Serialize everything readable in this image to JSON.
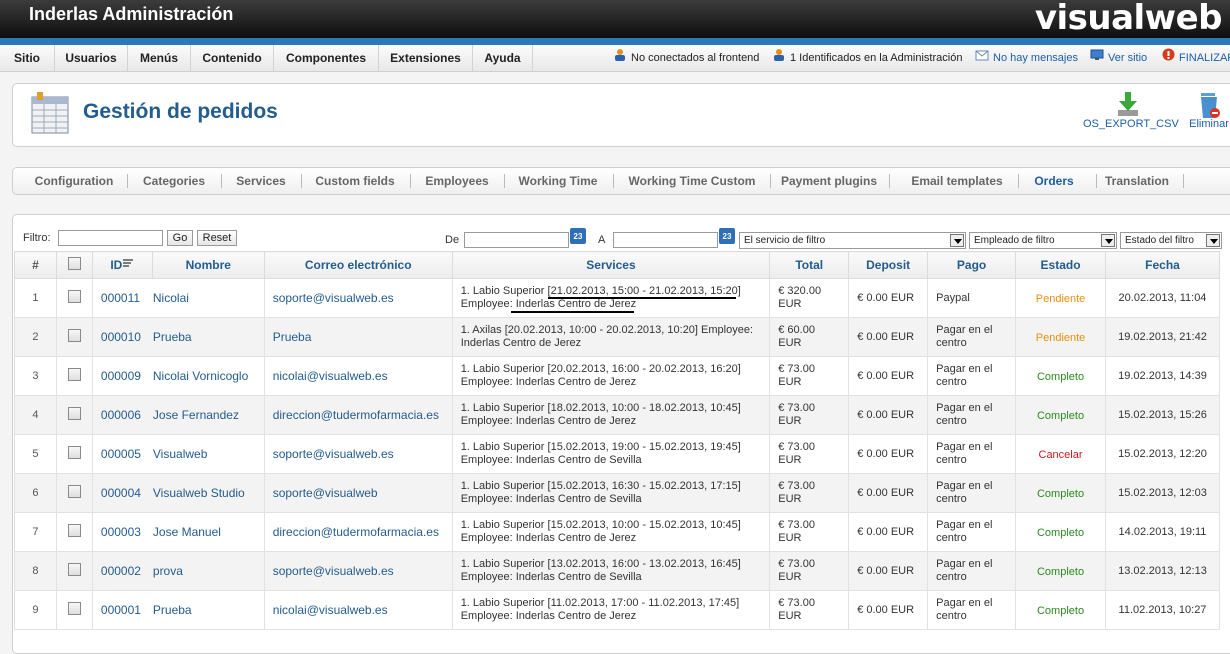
{
  "header": {
    "site_name": "Inderlas Administración",
    "logo": "visualweb"
  },
  "menu": [
    "Sitio",
    "Usuarios",
    "Menús",
    "Contenido",
    "Componentes",
    "Extensiones",
    "Ayuda"
  ],
  "status": {
    "frontend": "No conectados al frontend",
    "admin": "1 Identificados en la Administración",
    "messages": "No hay mensajes",
    "view_site": "Ver sitio",
    "logout": "FINALIZAR"
  },
  "page": {
    "title": "Gestión de pedidos",
    "export_label": "OS_EXPORT_CSV",
    "delete_label": "Eliminar"
  },
  "tabs": [
    "Configuration",
    "Categories",
    "Services",
    "Custom fields",
    "Employees",
    "Working Time",
    "Working Time Custom",
    "Payment plugins",
    "Email templates",
    "Orders",
    "Translation"
  ],
  "filter": {
    "label": "Filtro:",
    "go": "Go",
    "reset": "Reset",
    "from": "De",
    "to": "A",
    "cal": "23",
    "service_filter": "El servicio de filtro",
    "employee_filter": "Empleado de filtro",
    "status_filter": "Estado del filtro"
  },
  "columns": [
    "#",
    "ID",
    "Nombre",
    "Correo electrónico",
    "Services",
    "Total",
    "Deposit",
    "Pago",
    "Estado",
    "Fecha"
  ],
  "orders": [
    {
      "n": "1",
      "id": "000011",
      "name": "Nicolai",
      "email": "soporte@visualweb.es",
      "service1": "1. Labio Superior [21.02.2013, 15:00 - 21.02.2013, 15:20]",
      "service2": "Employee: Inderlas Centro de Jerez",
      "total": "€ 320.00 EUR",
      "deposit": "€ 0.00 EUR",
      "pago": "Paypal",
      "estado": "Pendiente",
      "fecha": "20.02.2013, 11:04"
    },
    {
      "n": "2",
      "id": "000010",
      "name": "Prueba",
      "email": "Prueba",
      "service1": "1. Axilas [20.02.2013, 10:00 - 20.02.2013, 10:20] Employee:",
      "service2": "Inderlas Centro de Jerez",
      "total": "€ 60.00 EUR",
      "deposit": "€ 0.00 EUR",
      "pago": "Pagar en el centro",
      "estado": "Pendiente",
      "fecha": "19.02.2013, 21:42"
    },
    {
      "n": "3",
      "id": "000009",
      "name": "Nicolai Vornicoglo",
      "email": "nicolai@visualweb.es",
      "service1": "1. Labio Superior [20.02.2013, 16:00 - 20.02.2013, 16:20]",
      "service2": "Employee: Inderlas Centro de Jerez",
      "total": "€ 73.00 EUR",
      "deposit": "€ 0.00 EUR",
      "pago": "Pagar en el centro",
      "estado": "Completo",
      "fecha": "19.02.2013, 14:39"
    },
    {
      "n": "4",
      "id": "000006",
      "name": "Jose Fernandez",
      "email": "direccion@tudermofarmacia.es",
      "service1": "1. Labio Superior [18.02.2013, 10:00 - 18.02.2013, 10:45]",
      "service2": "Employee: Inderlas Centro de Jerez",
      "total": "€ 73.00 EUR",
      "deposit": "€ 0.00 EUR",
      "pago": "Pagar en el centro",
      "estado": "Completo",
      "fecha": "15.02.2013, 15:26"
    },
    {
      "n": "5",
      "id": "000005",
      "name": "Visualweb",
      "email": "soporte@visualweb.es",
      "service1": "1. Labio Superior [15.02.2013, 19:00 - 15.02.2013, 19:45]",
      "service2": "Employee: Inderlas Centro de Sevilla",
      "total": "€ 73.00 EUR",
      "deposit": "€ 0.00 EUR",
      "pago": "Pagar en el centro",
      "estado": "Cancelar",
      "fecha": "15.02.2013, 12:20"
    },
    {
      "n": "6",
      "id": "000004",
      "name": "Visualweb Studio",
      "email": "soporte@visualweb",
      "service1": "1. Labio Superior [15.02.2013, 16:30 - 15.02.2013, 17:15]",
      "service2": "Employee: Inderlas Centro de Sevilla",
      "total": "€ 73.00 EUR",
      "deposit": "€ 0.00 EUR",
      "pago": "Pagar en el centro",
      "estado": "Completo",
      "fecha": "15.02.2013, 12:03"
    },
    {
      "n": "7",
      "id": "000003",
      "name": "Jose Manuel",
      "email": "direccion@tudermofarmacia.es",
      "service1": "1. Labio Superior [15.02.2013, 10:00 - 15.02.2013, 10:45]",
      "service2": "Employee: Inderlas Centro de Jerez",
      "total": "€ 73.00 EUR",
      "deposit": "€ 0.00 EUR",
      "pago": "Pagar en el centro",
      "estado": "Completo",
      "fecha": "14.02.2013, 19:11"
    },
    {
      "n": "8",
      "id": "000002",
      "name": "prova",
      "email": "soporte@visualweb.es",
      "service1": "1. Labio Superior [13.02.2013, 16:00 - 13.02.2013, 16:45]",
      "service2": "Employee: Inderlas Centro de Sevilla",
      "total": "€ 73.00 EUR",
      "deposit": "€ 0.00 EUR",
      "pago": "Pagar en el centro",
      "estado": "Completo",
      "fecha": "13.02.2013, 12:13"
    },
    {
      "n": "9",
      "id": "000001",
      "name": "Prueba",
      "email": "nicolai@visualweb.es",
      "service1": "1. Labio Superior [11.02.2013, 17:00 - 11.02.2013, 17:45]",
      "service2": "Employee: Inderlas Centro de Jerez",
      "total": "€ 73.00 EUR",
      "deposit": "€ 0.00 EUR",
      "pago": "Pagar en el centro",
      "estado": "Completo",
      "fecha": "11.02.2013, 10:27"
    }
  ],
  "colors": {
    "accent": "#235c8e",
    "pending": "#e8900c",
    "complete": "#2a8a1e",
    "cancel": "#cc1a1a"
  }
}
